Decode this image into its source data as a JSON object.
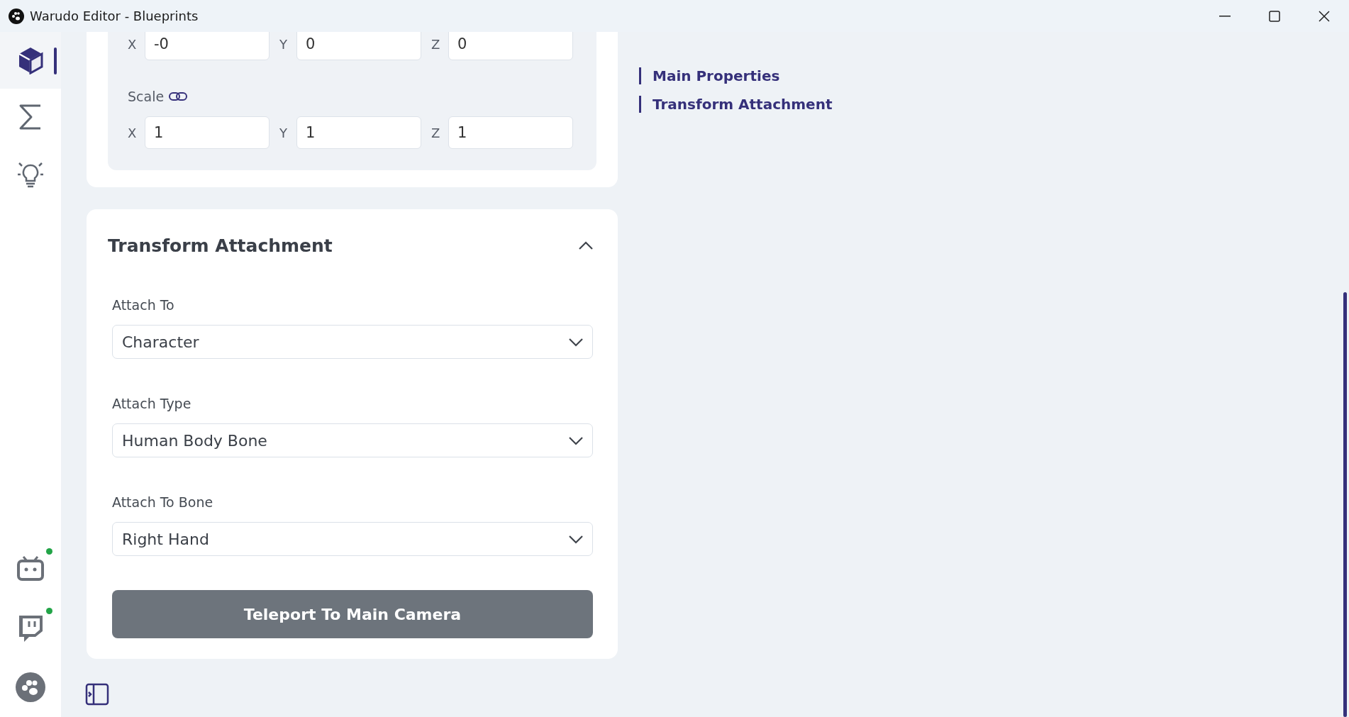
{
  "window": {
    "title": "Warudo Editor - Blueprints"
  },
  "sidebar": {
    "items": [
      {
        "kind": "cube",
        "selected": true
      },
      {
        "kind": "sigma",
        "selected": false
      },
      {
        "kind": "bulb",
        "selected": false
      }
    ],
    "bottom_items": [
      {
        "kind": "tv",
        "connected": true
      },
      {
        "kind": "chat",
        "connected": true
      },
      {
        "kind": "paw",
        "connected": false
      }
    ]
  },
  "properties": {
    "position_fields": [
      {
        "axis": "X",
        "value": "-0"
      },
      {
        "axis": "Y",
        "value": "0"
      },
      {
        "axis": "Z",
        "value": "0"
      }
    ],
    "scale": {
      "label": "Scale",
      "linked": true,
      "fields": [
        {
          "axis": "X",
          "value": "1"
        },
        {
          "axis": "Y",
          "value": "1"
        },
        {
          "axis": "Z",
          "value": "1"
        }
      ]
    }
  },
  "transform_attachment": {
    "title": "Transform Attachment",
    "expanded": true,
    "fields": [
      {
        "label": "Attach To",
        "value": "Character"
      },
      {
        "label": "Attach Type",
        "value": "Human Body Bone"
      },
      {
        "label": "Attach To Bone",
        "value": "Right Hand"
      }
    ],
    "button": "Teleport To Main Camera"
  },
  "outline": [
    {
      "label": "Main Properties"
    },
    {
      "label": "Transform Attachment"
    }
  ]
}
